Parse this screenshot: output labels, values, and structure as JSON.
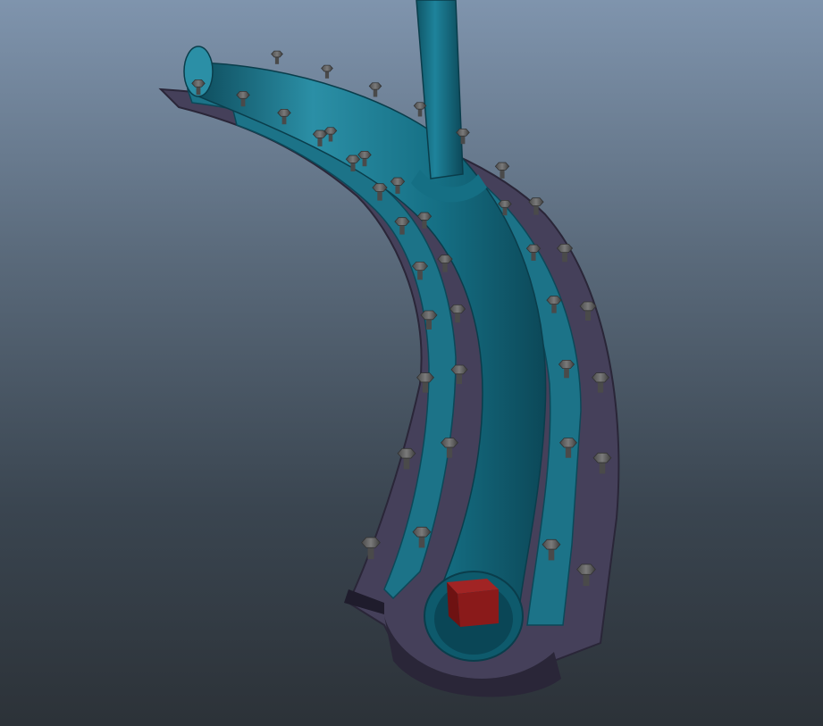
{
  "scene": {
    "colors": {
      "background_top": "#7f94ad",
      "background_bottom": "#2c3238",
      "pipe": "#156f84",
      "pipe_highlight": "#2b8fa6",
      "pipe_shadow": "#0c4858",
      "channel_plate": "#45405a",
      "channel_plate_dark": "#2a2638",
      "bolt": "#6f6f6f",
      "bolt_dark": "#3e3e3e",
      "block": "#8a1a1a"
    },
    "objects": [
      "curved-pipe",
      "vertical-branch-pipe",
      "outer-channel-plate",
      "inner-flange",
      "bolt-row-outer",
      "bolt-row-inner",
      "red-block"
    ]
  }
}
